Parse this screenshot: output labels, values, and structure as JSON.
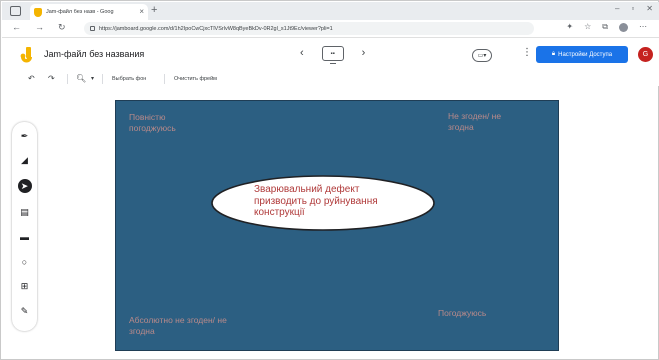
{
  "browser": {
    "tab_title": "Jam-файл без назв - Goog",
    "url": "https://jamboard.google.com/d/1h2IpoCwCjxcTlVSrlvW8qByeBkDv-0R2gl_s1Jt9Ec/viewer?pli=1"
  },
  "app": {
    "title": "Jam-файл без названия",
    "share_label": "Настройки Доступа",
    "avatar_initial": "G"
  },
  "toolbar": {
    "set_background": "Выбрать фон",
    "clear_frame": "Очистить фрейм"
  },
  "canvas": {
    "notes": {
      "top_left": "Повністю погоджуюсь",
      "top_right": "Не згоден/ не згодна",
      "bottom_left": "Абсолютно не згоден/ не згодна",
      "bottom_right": "Погоджуюсь"
    },
    "ellipse_text": "Зварювальний дефект призводить до руйнування конструкції"
  },
  "colors": {
    "canvas_bg": "#2c5f82",
    "share_button": "#1a73e8",
    "note_text": "#b98a8a",
    "ellipse_text": "#b03a3a"
  }
}
